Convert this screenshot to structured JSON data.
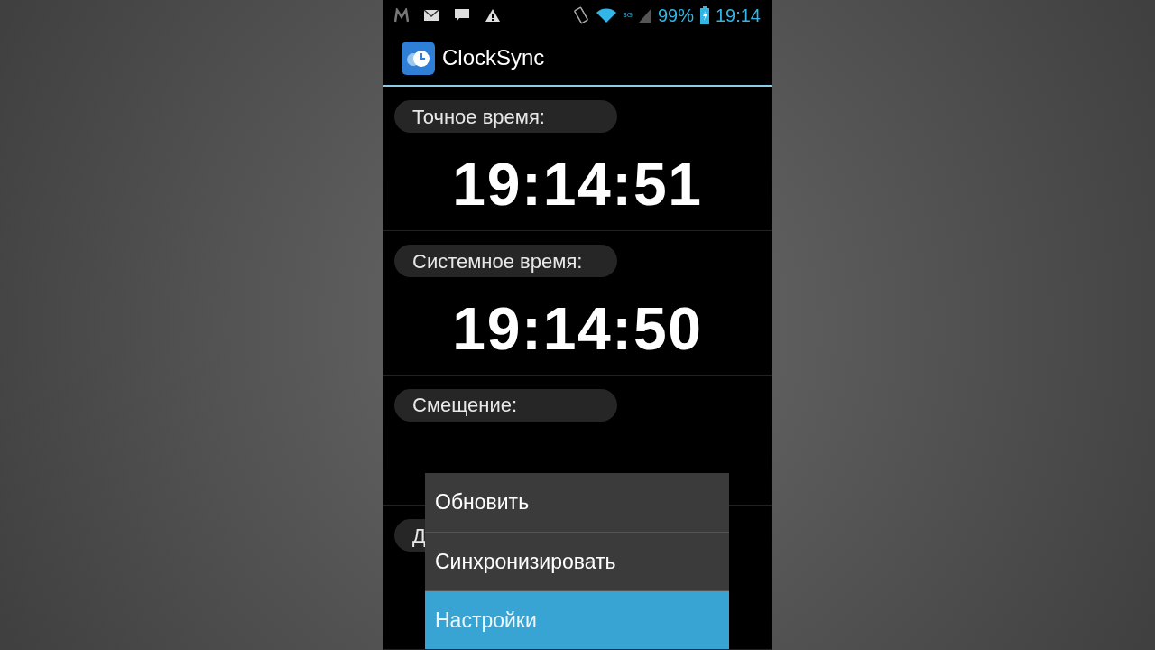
{
  "status_bar": {
    "network": "3G",
    "battery": "99%",
    "time": "19:14"
  },
  "app_bar": {
    "title": "ClockSync"
  },
  "sections": [
    {
      "label": "Точное время:",
      "value": "19:14:51"
    },
    {
      "label": "Системное время:",
      "value": "19:14:50"
    },
    {
      "label": "Смещение:"
    },
    {
      "label": "Д"
    }
  ],
  "menu": [
    {
      "label": "Обновить",
      "selected": false
    },
    {
      "label": "Синхронизировать",
      "selected": false
    },
    {
      "label": "Настройки",
      "selected": true
    }
  ]
}
